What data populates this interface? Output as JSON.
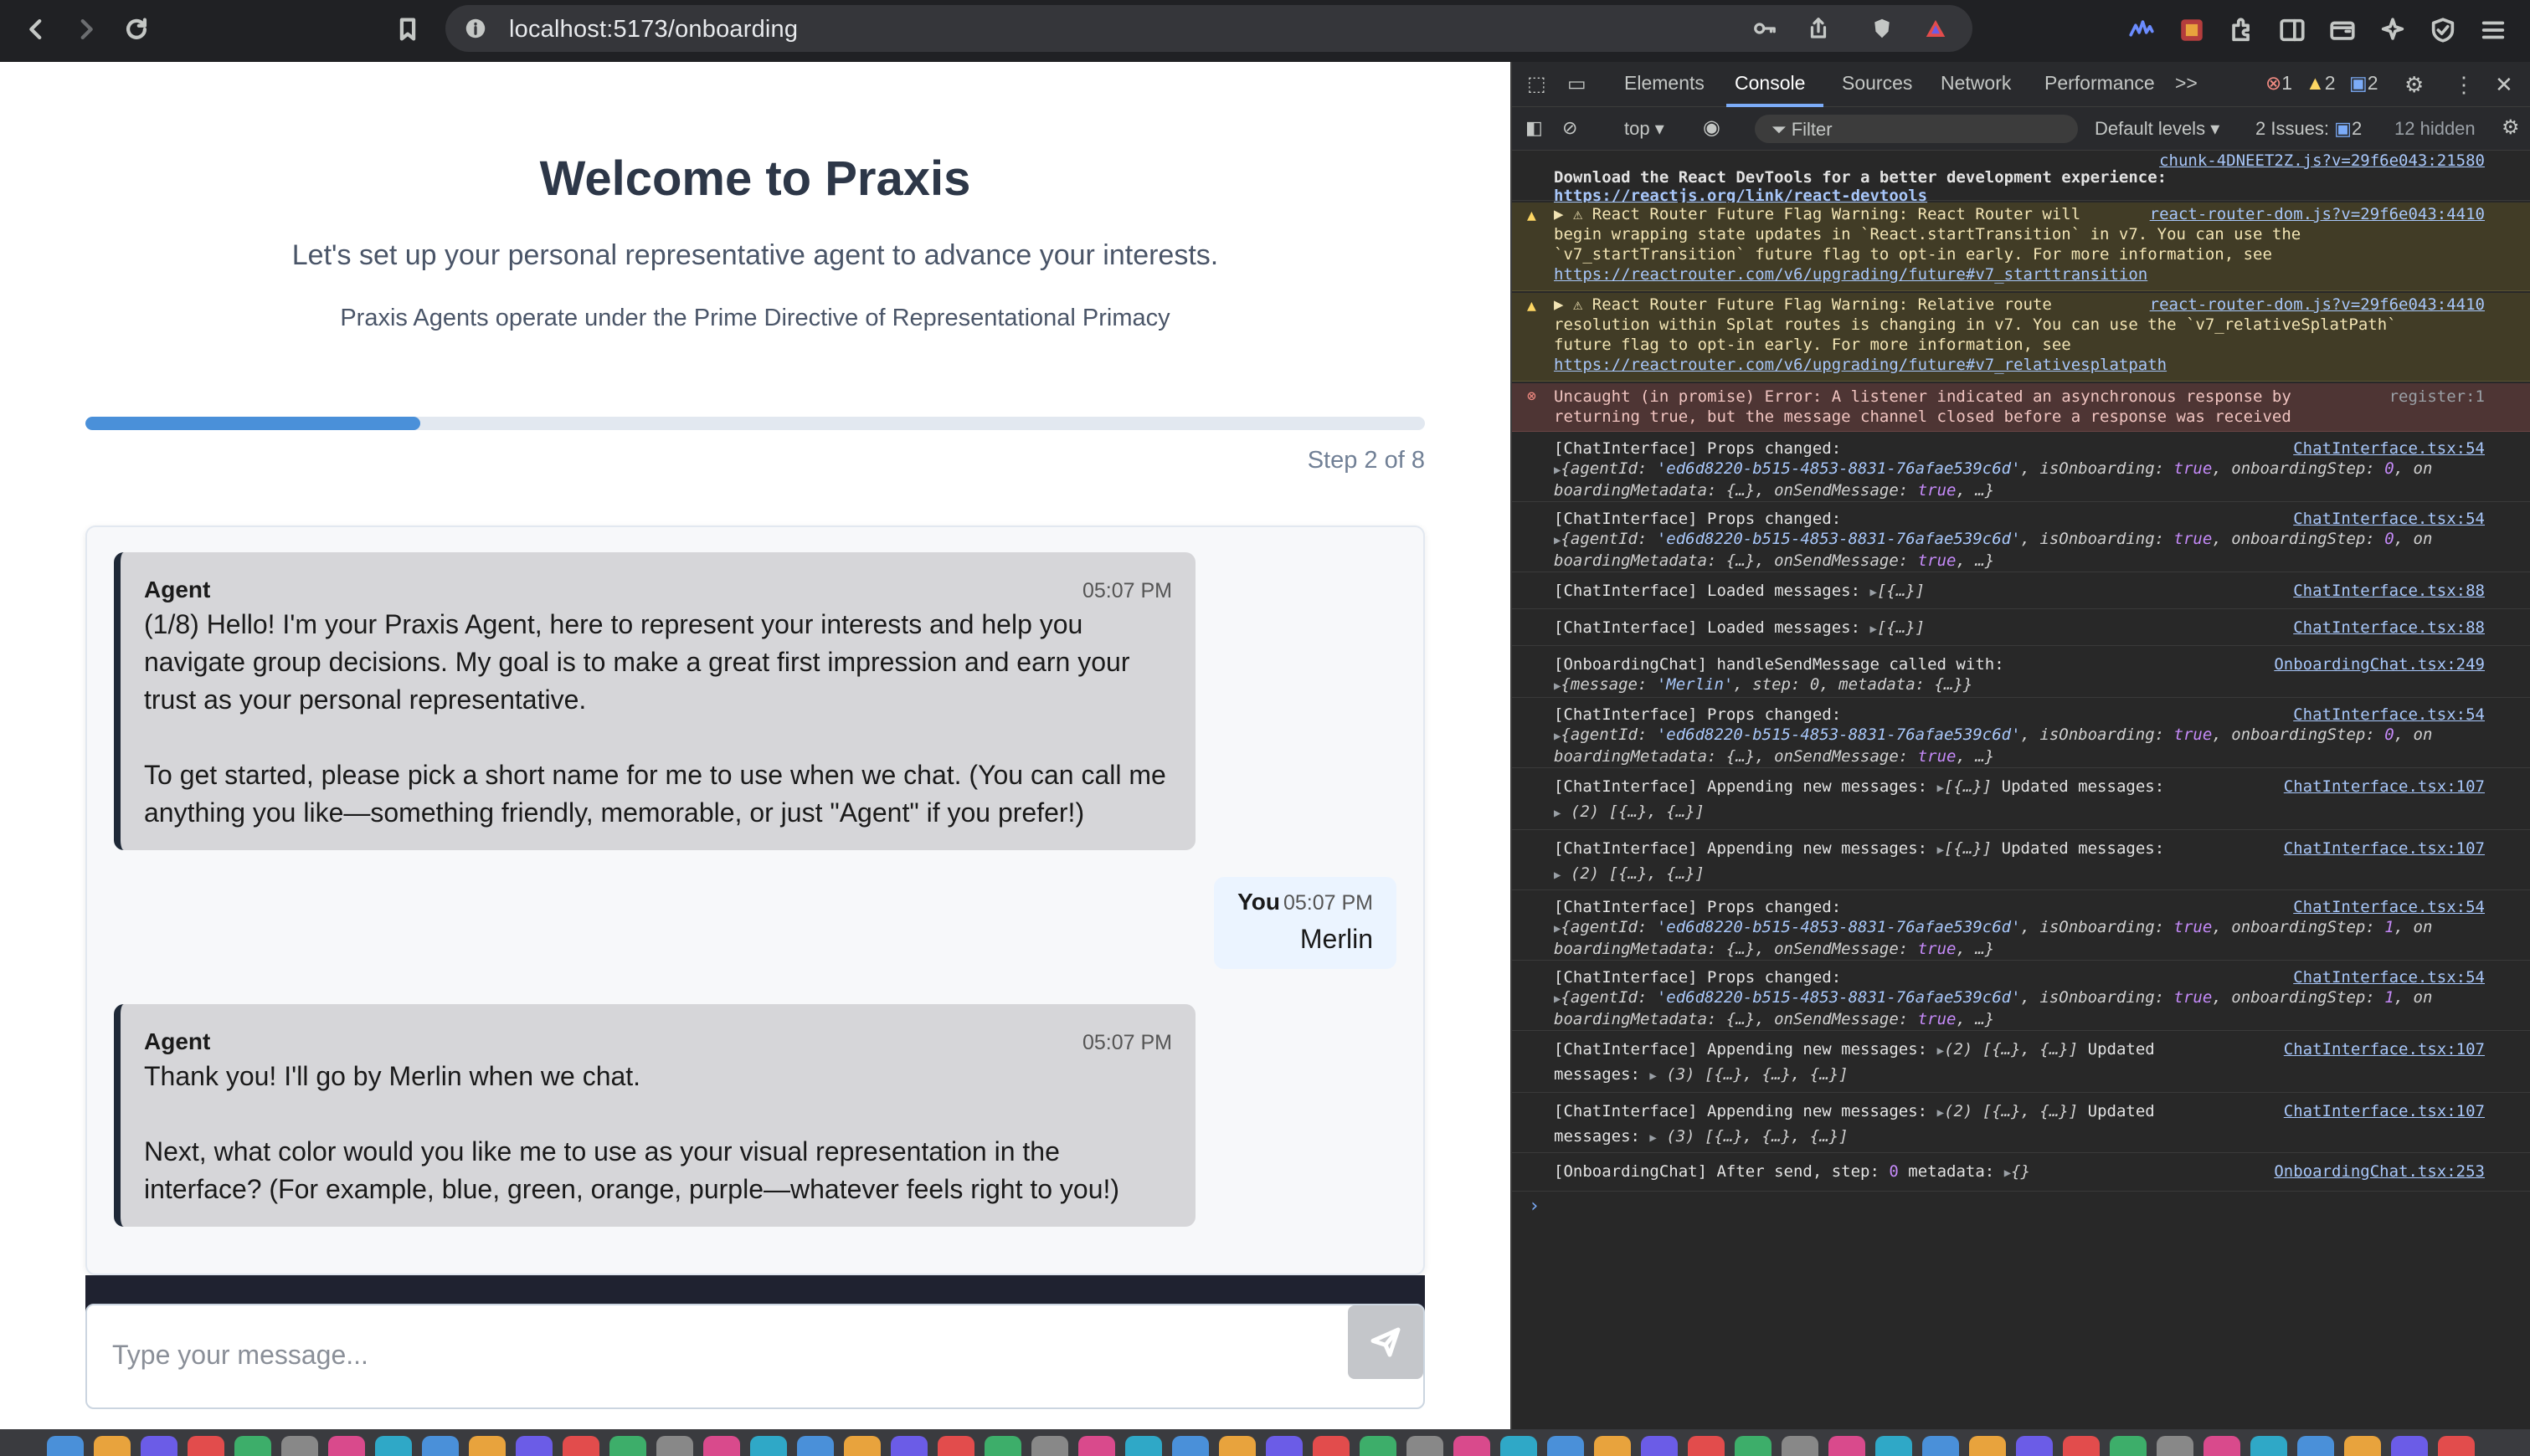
{
  "browser": {
    "url": "localhost:5173/onboarding"
  },
  "page": {
    "title": "Welcome to Praxis",
    "subtitle": "Let's set up your personal representative agent to advance your interests.",
    "directive": "Praxis Agents operate under the Prime Directive of Representational Primacy",
    "progress_fraction": 0.25,
    "step_label": "Step 2 of 8"
  },
  "chat": {
    "messages": [
      {
        "sender": "Agent",
        "time": "05:07 PM",
        "text": "(1/8) Hello! I'm your Praxis Agent, here to represent your interests and help you navigate group decisions. My goal is to make a great first impression and earn your trust as your personal representative.\n\nTo get started, please pick a short name for me to use when we chat. (You can call me anything you like—something friendly, memorable, or just \"Agent\" if you prefer!)"
      },
      {
        "sender": "You",
        "time": "05:07 PM",
        "text": "Merlin"
      },
      {
        "sender": "Agent",
        "time": "05:07 PM",
        "text": "Thank you! I'll go by Merlin when we chat.\n\nNext, what color would you like me to use as your visual representation in the interface? (For example, blue, green, orange, purple—whatever feels right to you!)"
      }
    ],
    "input_placeholder": "Type your message..."
  },
  "devtools": {
    "tabs": [
      "Elements",
      "Console",
      "Sources",
      "Network",
      "Performance"
    ],
    "active_tab": "Console",
    "more_tabs": ">>",
    "badges": {
      "errors": "1",
      "warnings": "2",
      "messages": "2"
    },
    "toolbar": {
      "context": "top",
      "filter_placeholder": "Filter",
      "levels": "Default levels",
      "issues_label": "2 Issues:",
      "issues_count": "2",
      "hidden": "12 hidden"
    },
    "logs": {
      "l0_src": "chunk-4DNEET2Z.js?v=29f6e043:21580",
      "l0_text": "Download the React DevTools for a better development experience:",
      "l0_link": "https://reactjs.org/link/react-devtools",
      "l1_src": "react-router-dom.js?v=29f6e043:4410",
      "l1_line1": "▶ ⚠ React Router Future Flag Warning: React Router will",
      "l1_line2": "begin wrapping state updates in `React.startTransition` in v7. You can use the",
      "l1_line3": "`v7_startTransition` future flag to opt-in early. For more information, see",
      "l1_link": "https://reactrouter.com/v6/upgrading/future#v7_starttransition",
      "l2_src": "react-router-dom.js?v=29f6e043:4410",
      "l2_line1": "▶ ⚠ React Router Future Flag Warning: Relative route",
      "l2_line2": "resolution within Splat routes is changing in v7. You can use the `v7_relativeSplatPath`",
      "l2_line3": "future flag to opt-in early. For more information, see",
      "l2_link": "https://reactrouter.com/v6/upgrading/future#v7_relativesplatpath",
      "l3_src": "register:1",
      "l3_line1": "Uncaught (in promise) Error: A listener indicated an asynchronous response by",
      "l3_line2": "returning true, but the message channel closed before a response was received",
      "props_label": "[ChatInterface] Props changed:",
      "props_src": "ChatInterface.tsx:54",
      "props_pre": "{agentId: ",
      "props_agentid": "'ed6d8220-b515-4853-8831-76afae539c6d'",
      "props_mid1": ", isOnboarding: ",
      "props_true": "true",
      "props_mid2": ", onboardingStep: ",
      "props_step0": "0",
      "props_step1": "1",
      "props_tail": ", on",
      "props_line2_a": "boardingMetadata: {…}, onSendMessage: ",
      "props_line2_b": ", …}",
      "loaded_label": "[ChatInterface] Loaded messages:",
      "loaded_val": "[{…}]",
      "loaded_src": "ChatInterface.tsx:88",
      "handle_label": "[OnboardingChat] handleSendMessage called with:",
      "handle_src": "OnboardingChat.tsx:249",
      "handle_pre": "{message: ",
      "handle_msg": "'Merlin'",
      "handle_post": ", step: 0, metadata: {…}}",
      "append_label": "[ChatInterface] Appending new messages:",
      "append_src": "ChatInterface.tsx:107",
      "append_v1": "[{…}]",
      "append_updated": "Updated messages:",
      "append_r1": "(2) [{…}, {…}]",
      "append_v2": "(2) [{…}, {…}]",
      "append_updated2": "Updated",
      "append_messages": "messages:",
      "append_r2": "(3) [{…}, {…}, {…}]",
      "after_label": "[OnboardingChat] After send, step:",
      "after_step": "0",
      "after_meta": "metadata:",
      "after_val": "{}",
      "after_src": "OnboardingChat.tsx:253",
      "prompt": "›"
    }
  }
}
